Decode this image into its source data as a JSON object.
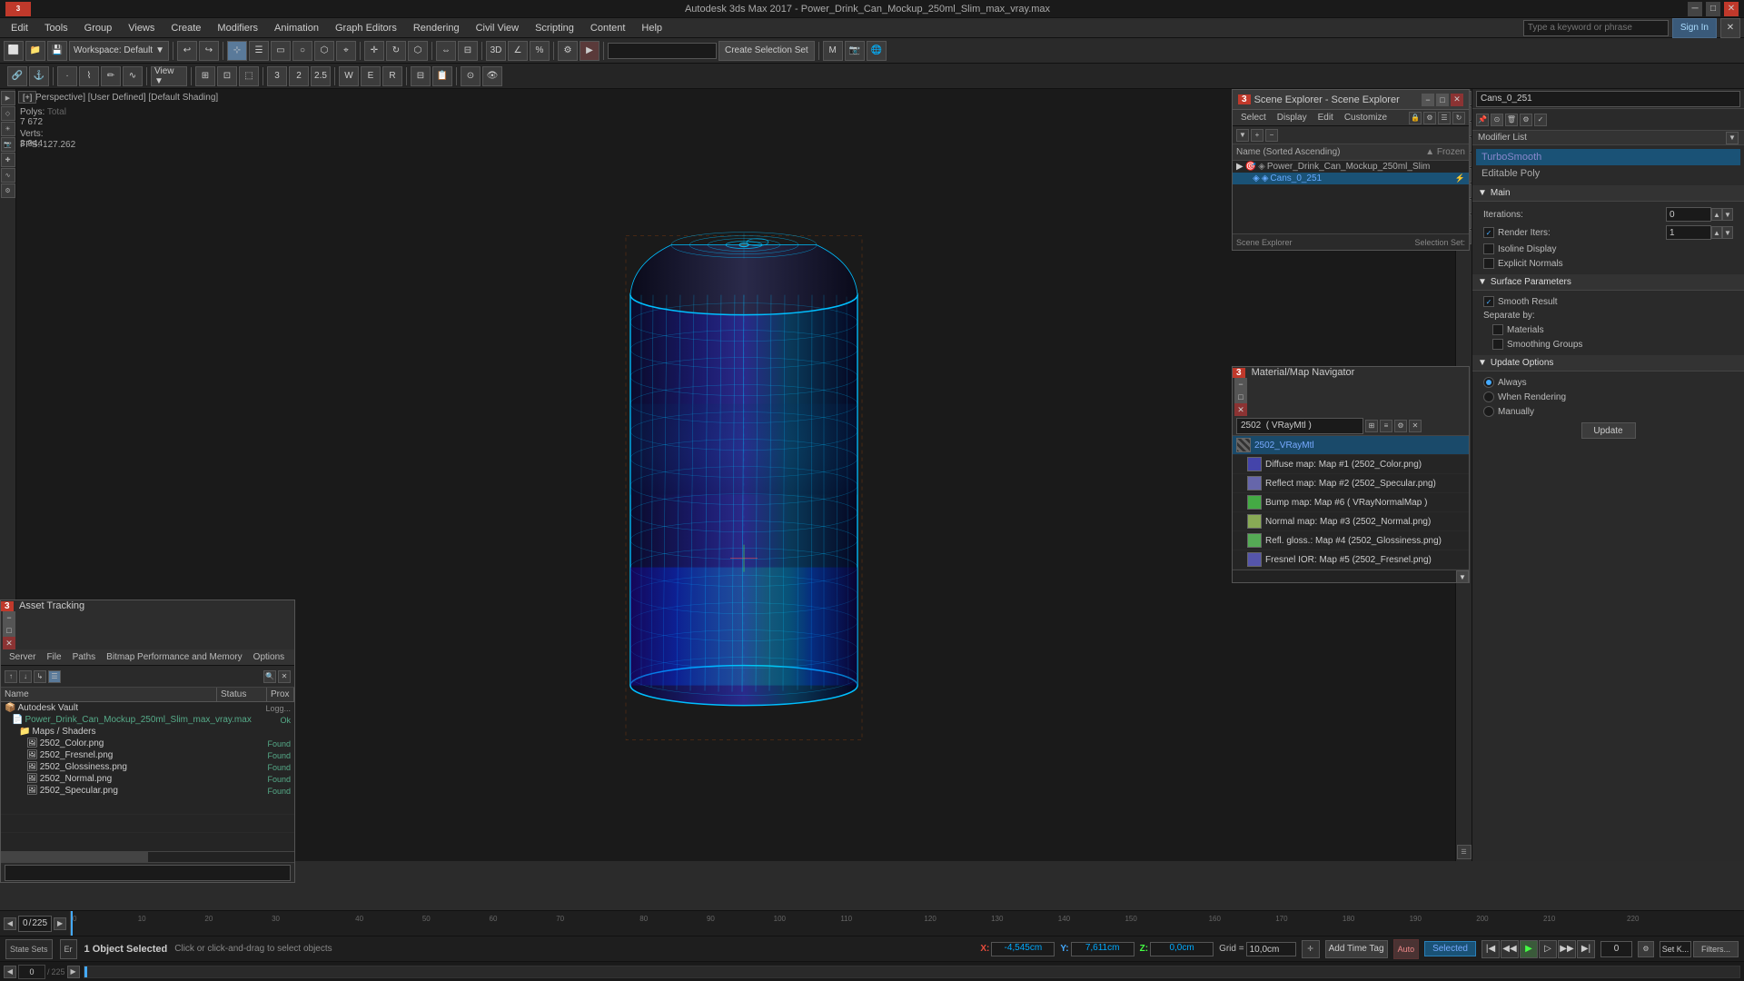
{
  "window": {
    "title": "Autodesk 3ds Max 2017 - Power_Drink_Can_Mockup_250ml_Slim_max_vray.max",
    "logo": "3ds-max-logo"
  },
  "menu": {
    "items": [
      "Edit",
      "Tools",
      "Group",
      "Views",
      "Create",
      "Modifiers",
      "Animation",
      "Graph Editors",
      "Rendering",
      "Civil View",
      "Animation",
      "Scripting",
      "Content",
      "Help"
    ]
  },
  "toolbar1": {
    "workspace": "Workspace: Default",
    "create_selection_set": "Create Selection Set",
    "search_placeholder": "Type a keyword or phrase",
    "sign_in": "Sign In"
  },
  "viewport": {
    "label": "[+] [Perspective] [User Defined] [Default Shading]",
    "stats_polys_label": "Polys:",
    "stats_polys_total": "Total",
    "stats_polys_value": "7 672",
    "stats_verts_label": "Verts:",
    "stats_verts_value": "3 944",
    "fps_label": "FPS:",
    "fps_value": "127.262"
  },
  "scene_explorer": {
    "title": "Scene Explorer - Scene Explorer",
    "toolbar": {
      "select": "Select",
      "display": "Display",
      "edit": "Edit",
      "customize": "Customize"
    },
    "sort_label": "Name (Sorted Ascending)",
    "frozen_label": "▲ Frozen",
    "tree": [
      {
        "level": 0,
        "name": "Power_Drink_Can_Mockup_250ml_Slim",
        "type": "group",
        "icon": "▶"
      },
      {
        "level": 1,
        "name": "Cans_0_251",
        "type": "object",
        "selected": true
      }
    ]
  },
  "modifier_list": {
    "title": "Modifier List",
    "object_name": "Cans_0_251",
    "items": [
      "TurboSmooth",
      "Editable Poly"
    ],
    "turbosmooth": {
      "main_label": "Main",
      "iterations_label": "Iterations:",
      "iterations_value": "0",
      "render_iters_label": "Render Iters:",
      "render_iters_value": "1",
      "isoline_display": "Isoline Display",
      "explicit_normals": "Explicit Normals"
    },
    "surface_parameters": {
      "label": "Surface Parameters",
      "smooth_result": "Smooth Result",
      "separate_by_label": "Separate by:",
      "materials": "Materials",
      "smoothing_groups": "Smoothing Groups"
    },
    "update_options": {
      "label": "Update Options",
      "always": "Always",
      "when_rendering": "When Rendering",
      "manually": "Manually",
      "update_btn": "Update"
    }
  },
  "material_nav": {
    "title": "Material/Map Navigator",
    "input_value": "2502 ( VRayMtl )",
    "maps": [
      {
        "label": "2502_VRayMtl",
        "type": "root",
        "selected": true
      },
      {
        "label": "Diffuse map: Map #1 (2502_Color.png)",
        "type": "map"
      },
      {
        "label": "Reflect map: Map #2 (2502_Specular.png)",
        "type": "map"
      },
      {
        "label": "Bump map: Map #6  ( VRayNormalMap )",
        "type": "map"
      },
      {
        "label": "Normal map: Map #3 (2502_Normal.png)",
        "type": "map"
      },
      {
        "label": "Refl. gloss.: Map #4 (2502_Glossiness.png)",
        "type": "map"
      },
      {
        "label": "Fresnel IOR: Map #5 (2502_Fresnel.png)",
        "type": "map"
      }
    ]
  },
  "asset_tracking": {
    "title": "Asset Tracking",
    "menu_items": [
      "Server",
      "File",
      "Paths",
      "Bitmap Performance and Memory",
      "Options"
    ],
    "columns": [
      "Name",
      "Status",
      "Prox"
    ],
    "tree": [
      {
        "level": 0,
        "name": "Autodesk Vault",
        "status": "Logg...",
        "prox": ""
      },
      {
        "level": 1,
        "name": "Power_Drink_Can_Mockup_250ml_Slim_max_vray.max",
        "status": "Ok",
        "prox": ""
      },
      {
        "level": 2,
        "name": "Maps / Shaders",
        "status": "",
        "prox": ""
      },
      {
        "level": 3,
        "name": "2502_Color.png",
        "status": "Found",
        "prox": ""
      },
      {
        "level": 3,
        "name": "2502_Fresnel.png",
        "status": "Found",
        "prox": ""
      },
      {
        "level": 3,
        "name": "2502_Glossiness.png",
        "status": "Found",
        "prox": ""
      },
      {
        "level": 3,
        "name": "2502_Normal.png",
        "status": "Found",
        "prox": ""
      },
      {
        "level": 3,
        "name": "2502_Specular.png",
        "status": "Found",
        "prox": ""
      }
    ]
  },
  "status_bar": {
    "object_selected": "1 Object Selected",
    "instruction": "Click or click-and-drag to select objects",
    "x_label": "X:",
    "x_value": "-4,545cm",
    "y_label": "Y:",
    "y_value": "7,611cm",
    "z_label": "Z:",
    "z_value": "0,0cm",
    "grid_label": "Grid =",
    "grid_value": "10,0cm",
    "add_time_tag": "Add Time Tag",
    "auto": "Auto",
    "selected": "Selected",
    "filters_btn": "Filters..."
  },
  "timeline": {
    "current_frame": "0",
    "total_frames": "225",
    "markers": [
      "0",
      "10",
      "20",
      "30",
      "40",
      "50",
      "60",
      "70",
      "80",
      "90",
      "100",
      "110",
      "120",
      "130",
      "140",
      "150",
      "160",
      "170",
      "180",
      "190",
      "200",
      "210",
      "220"
    ]
  },
  "bottom_tabs": {
    "state_sets": "State Sets",
    "er_label": "Er"
  },
  "colors": {
    "accent_blue": "#00bfff",
    "selection_blue": "#1a5276",
    "active_modifier": "#1a5276",
    "found_green": "#27ae60",
    "ok_green": "#27ae60",
    "toolbar_bg": "#2a2a2a",
    "panel_bg": "#2d2d2d"
  }
}
